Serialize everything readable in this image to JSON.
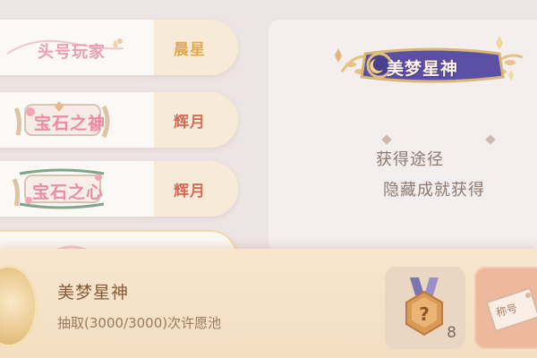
{
  "titles": [
    {
      "art_text": "头号玩家",
      "rank": "晨星",
      "rank_color": "#e1a64a"
    },
    {
      "art_text": "宝石之神",
      "rank": "辉月",
      "rank_color": "#d66a52"
    },
    {
      "art_text": "宝石之心",
      "rank": "辉月",
      "rank_color": "#d66a52"
    }
  ],
  "detail": {
    "banner_text": "美梦星神",
    "source_label": "获得途径",
    "source_value": "隐藏成就获得"
  },
  "bottom": {
    "name": "美梦星神",
    "description": "抽取(3000/3000)次许愿池",
    "medal_count": "8",
    "tag_label": "称号"
  }
}
